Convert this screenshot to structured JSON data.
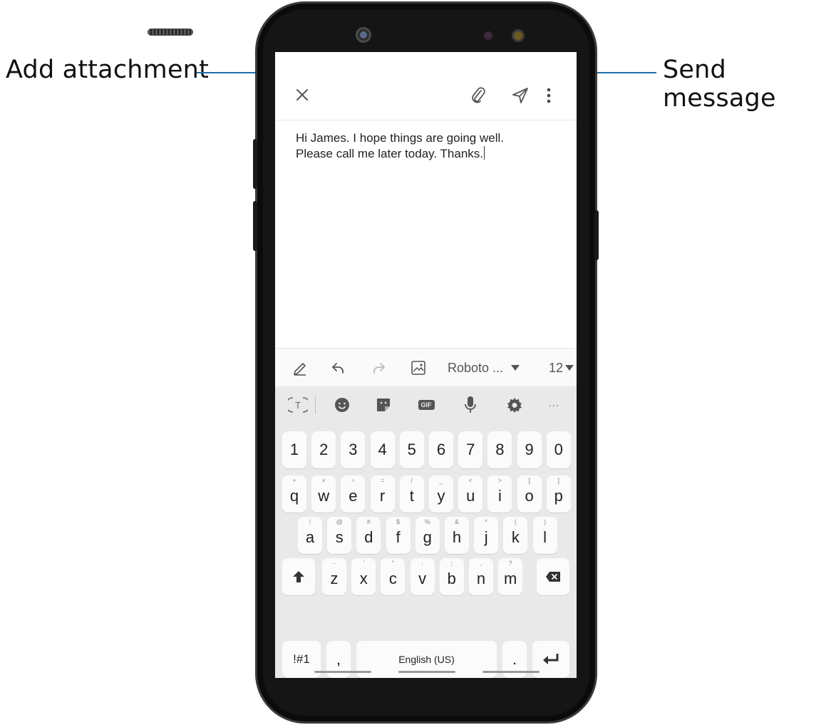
{
  "callouts": {
    "attachment": "Add attachment",
    "send": "Send message"
  },
  "toolbar": {
    "close_icon": "close-icon",
    "attach_icon": "paperclip-icon",
    "send_icon": "send-icon",
    "more_icon": "more-vertical-icon"
  },
  "message": {
    "body": "Hi James. I hope things are going well.\nPlease call me later today. Thanks."
  },
  "format_bar": {
    "pen_icon": "pen-icon",
    "undo_icon": "undo-icon",
    "redo_icon": "redo-icon",
    "image_icon": "image-icon",
    "font": "Roboto ...",
    "font_size": "12"
  },
  "keyboard": {
    "tools": {
      "translate_icon": "translate-icon",
      "emoji_icon": "emoji-icon",
      "sticker_icon": "sticker-icon",
      "gif_label": "GIF",
      "mic_icon": "mic-icon",
      "settings_icon": "gear-icon",
      "more_label": "···"
    },
    "row_numbers": [
      "1",
      "2",
      "3",
      "4",
      "5",
      "6",
      "7",
      "8",
      "9",
      "0"
    ],
    "row_qwerty": [
      {
        "sup": "+",
        "key": "q"
      },
      {
        "sup": "×",
        "key": "w"
      },
      {
        "sup": "÷",
        "key": "e"
      },
      {
        "sup": "=",
        "key": "r"
      },
      {
        "sup": "/",
        "key": "t"
      },
      {
        "sup": "_",
        "key": "y"
      },
      {
        "sup": "<",
        "key": "u"
      },
      {
        "sup": ">",
        "key": "i"
      },
      {
        "sup": "[",
        "key": "o"
      },
      {
        "sup": "]",
        "key": "p"
      }
    ],
    "row_asdf": [
      {
        "sup": "!",
        "key": "a"
      },
      {
        "sup": "@",
        "key": "s"
      },
      {
        "sup": "#",
        "key": "d"
      },
      {
        "sup": "$",
        "key": "f"
      },
      {
        "sup": "%",
        "key": "g"
      },
      {
        "sup": "&",
        "key": "h"
      },
      {
        "sup": "*",
        "key": "j"
      },
      {
        "sup": "(",
        "key": "k"
      },
      {
        "sup": ")",
        "key": "l"
      }
    ],
    "row_zxcv": [
      {
        "sup": "-",
        "key": "z"
      },
      {
        "sup": "'",
        "key": "x"
      },
      {
        "sup": "\"",
        "key": "c"
      },
      {
        "sup": ":",
        "key": "v"
      },
      {
        "sup": ";",
        "key": "b"
      },
      {
        "sup": ",",
        "key": "n"
      },
      {
        "sup": "?",
        "key": "m"
      }
    ],
    "shift_icon": "shift-icon",
    "backspace_icon": "backspace-icon",
    "symbols_label": "!#1",
    "comma_label": ",",
    "space_label": "English (US)",
    "period_label": ".",
    "enter_icon": "enter-icon"
  },
  "colors": {
    "callout_line": "#1f6fa8",
    "keyboard_bg": "#e9e9e9",
    "key_bg": "#fbfbfb"
  }
}
